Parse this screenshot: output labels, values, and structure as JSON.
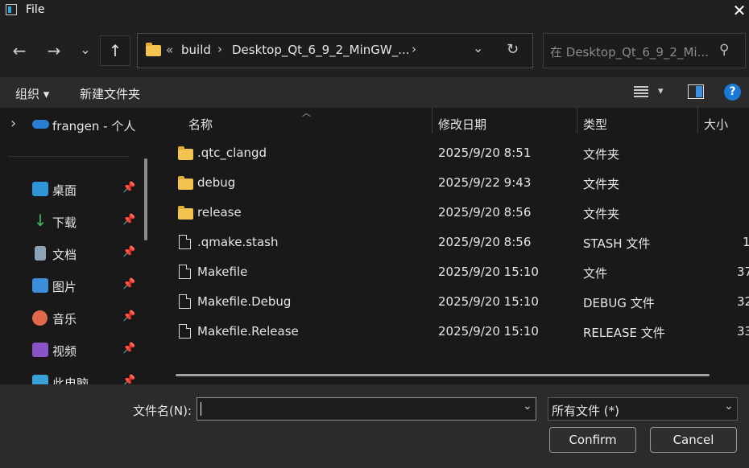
{
  "window": {
    "title": "File",
    "close": "✕"
  },
  "nav": {
    "back": "←",
    "forward": "→",
    "recent": "⌄",
    "up": "↑",
    "address": {
      "overflow": "«",
      "crumbs": [
        "build",
        "Desktop_Qt_6_9_2_MinGW_..."
      ],
      "sep": "›",
      "dropdown": "⌄",
      "refresh": "↻"
    },
    "search": {
      "placeholder": "在 Desktop_Qt_6_9_2_Mi...",
      "icon": "⚲"
    }
  },
  "toolbar": {
    "organize": "组织 ▾",
    "new_folder": "新建文件夹",
    "view_menu": "▾",
    "help": "?"
  },
  "sidebar": {
    "onedrive": {
      "chevron": "›",
      "label": "frangen - 个人"
    },
    "items": [
      {
        "label": "桌面",
        "icon": "desktop-icon",
        "color": "#2f95d6"
      },
      {
        "label": "下载",
        "icon": "download-icon",
        "color": "#3fb860"
      },
      {
        "label": "文档",
        "icon": "document-icon",
        "color": "#8fa3b8"
      },
      {
        "label": "图片",
        "icon": "pictures-icon",
        "color": "#3a8fd8"
      },
      {
        "label": "音乐",
        "icon": "music-icon",
        "color": "#e06a4a"
      },
      {
        "label": "视频",
        "icon": "video-icon",
        "color": "#8a54c9"
      },
      {
        "label": "此电脑",
        "icon": "computer-icon",
        "color": "#3aa0d8"
      }
    ],
    "pin": "📌"
  },
  "columns": {
    "name": "名称",
    "modified": "修改日期",
    "type": "类型",
    "size": "大小",
    "sort": "︿"
  },
  "files": [
    {
      "name": ".qtc_clangd",
      "modified": "2025/9/20 8:51",
      "type": "文件夹",
      "size": "",
      "kind": "folder"
    },
    {
      "name": "debug",
      "modified": "2025/9/22 9:43",
      "type": "文件夹",
      "size": "",
      "kind": "folder"
    },
    {
      "name": "release",
      "modified": "2025/9/20 8:56",
      "type": "文件夹",
      "size": "",
      "kind": "folder"
    },
    {
      "name": ".qmake.stash",
      "modified": "2025/9/20 8:56",
      "type": "STASH 文件",
      "size": "1",
      "kind": "file"
    },
    {
      "name": "Makefile",
      "modified": "2025/9/20 15:10",
      "type": "文件",
      "size": "37",
      "kind": "file"
    },
    {
      "name": "Makefile.Debug",
      "modified": "2025/9/20 15:10",
      "type": "DEBUG 文件",
      "size": "32",
      "kind": "file"
    },
    {
      "name": "Makefile.Release",
      "modified": "2025/9/20 15:10",
      "type": "RELEASE 文件",
      "size": "33",
      "kind": "file"
    }
  ],
  "footer": {
    "filename_label": "文件名(N):",
    "filename_value": "",
    "dropdown": "⌄",
    "filetype": "所有文件 (*)",
    "confirm": "Confirm",
    "cancel": "Cancel"
  }
}
